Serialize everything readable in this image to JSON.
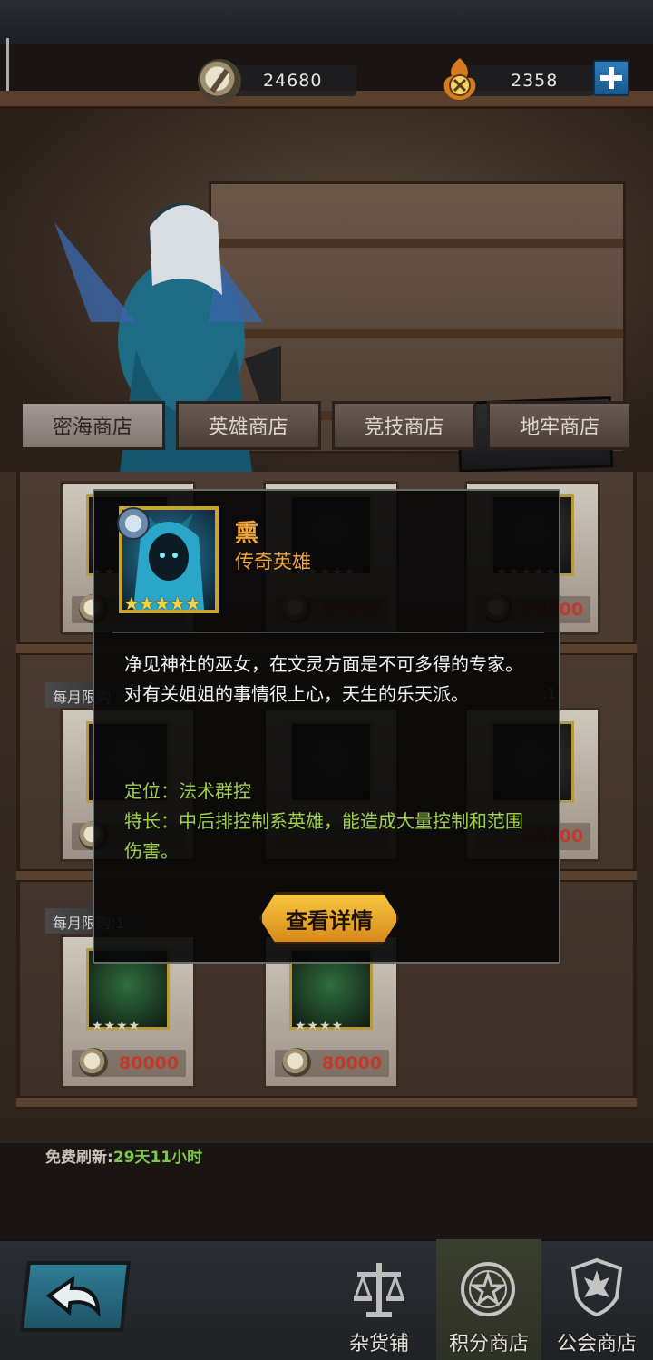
{
  "currency": {
    "coin_amount": "24680",
    "arena_amount": "2358"
  },
  "scene": {
    "sign_label": "密海商店"
  },
  "shop_tabs": [
    {
      "label": "密海商店",
      "active": true
    },
    {
      "label": "英雄商店",
      "active": false
    },
    {
      "label": "竞技商店",
      "active": false
    },
    {
      "label": "地牢商店",
      "active": false
    }
  ],
  "grid": {
    "limit_labels": [
      "每月限购",
      ":1",
      "每月限购:1"
    ],
    "items": [
      {
        "price": "80000",
        "stars": "★★★★★"
      },
      {
        "price": "80000",
        "stars": "★★★★★"
      },
      {
        "price": "80000",
        "stars": "★★★★★"
      },
      {
        "price": "80000",
        "stars": "★★★★"
      },
      {
        "price": "80000",
        "stars": "★★★★"
      }
    ],
    "row2_price": "80000"
  },
  "refresh": {
    "label": "免费刷新:",
    "time": "29天11小时"
  },
  "popup": {
    "hero_name": "熏",
    "rarity": "传奇英雄",
    "stars": "★★★★★",
    "description": "净见神社的巫女，在文灵方面是不可多得的专家。对有关姐姐的事情很上心，天生的乐天派。",
    "role_line": "定位：法术群控",
    "specialty_line": "特长：中后排控制系英雄，能造成大量控制和范围伤害。",
    "detail_button": "查看详情"
  },
  "bottom_nav": [
    {
      "label": "杂货铺",
      "icon": "scale-icon",
      "active": false
    },
    {
      "label": "积分商店",
      "icon": "star-badge-icon",
      "active": true
    },
    {
      "label": "公会商店",
      "icon": "guild-shield-icon",
      "active": false
    }
  ],
  "colors": {
    "accent_gold": "#f0a53a",
    "highlight_green": "#9ed04c",
    "price_red": "#c0392b"
  }
}
